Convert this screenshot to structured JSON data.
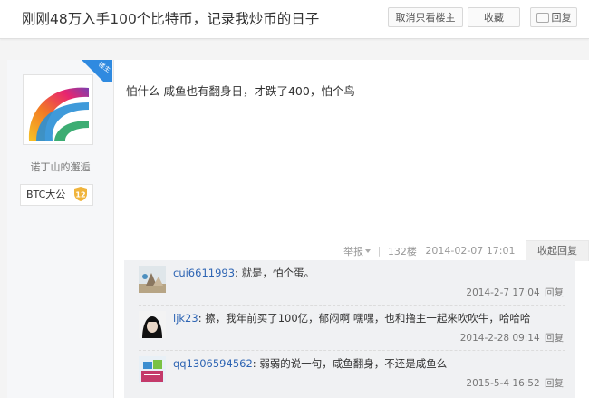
{
  "header": {
    "title": "刚刚48万入手100个比特币，记录我炒币的日子",
    "only_op_label": "取消只看楼主",
    "favorite_label": "收藏",
    "reply_label": "回复"
  },
  "post": {
    "author": {
      "name": "诺丁山的邂逅",
      "badge": "楼主",
      "level_label": "BTC大公",
      "level": "12"
    },
    "content": "怕什么 咸鱼也有翻身日，才跌了400，怕个鸟",
    "tail": {
      "report_label": "举报",
      "floor": "132楼",
      "time": "2014-02-07 17:01",
      "fold_label": "收起回复"
    }
  },
  "replies": [
    {
      "user": "cui6611993",
      "text": "就是，怕个蛋。",
      "time": "2014-2-7 17:04",
      "reply_label": "回复"
    },
    {
      "user": "ljk23",
      "text": "擦，我年前买了100亿，郁闷啊 嘿嘿，也和撸主一起来吹吹牛，哈哈哈",
      "time": "2014-2-28 09:14",
      "reply_label": "回复"
    },
    {
      "user": "qq1306594562",
      "text": "弱弱的说一句，咸鱼翻身，不还是咸鱼么",
      "time": "2015-5-4 16:52",
      "reply_label": "回复"
    }
  ],
  "colors": {
    "link": "#2d64b3",
    "badge": "#2f8ae0",
    "level_shield": "#f0b43c"
  }
}
